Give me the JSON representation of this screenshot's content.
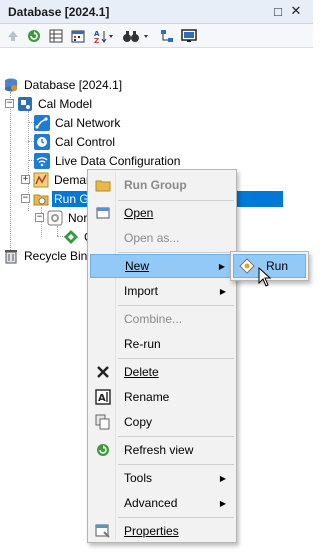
{
  "panel": {
    "title": "Database [2024.1]",
    "pin_glyph": "□",
    "close_glyph": "✕"
  },
  "toolbar": {
    "icons": [
      "up-arrow-icon",
      "refresh-icon",
      "properties-grid-icon",
      "calendar-icon",
      "sort-az-icon",
      "binoculars-search-icon",
      "hierarchy-icon",
      "monitor-icon"
    ]
  },
  "tree": {
    "root": "Database [2024.1]",
    "cal_model": "Cal Model",
    "cal_network": "Cal Network",
    "cal_control": "Cal Control",
    "live_data": "Live Data Configuration",
    "demand": "Deman",
    "run_group": "Run Gr",
    "nor": "Nor",
    "c_item": "C",
    "recycle_bin": "Recycle Bin",
    "expander_minus": "−",
    "expander_plus": "+"
  },
  "context_menu": {
    "header": "Run Group",
    "open": "Open",
    "open_as": "Open as...",
    "new": "New",
    "import": "Import",
    "combine": "Combine...",
    "rerun": "Re-run",
    "delete": "Delete",
    "rename": "Rename",
    "copy": "Copy",
    "refresh_view": "Refresh view",
    "tools": "Tools",
    "advanced": "Advanced",
    "properties": "Properties"
  },
  "submenu": {
    "run": "Run"
  },
  "colors": {
    "selection": "#0078d7",
    "menu_highlight": "#91c9f7",
    "titlebar": "#e8eef7"
  }
}
